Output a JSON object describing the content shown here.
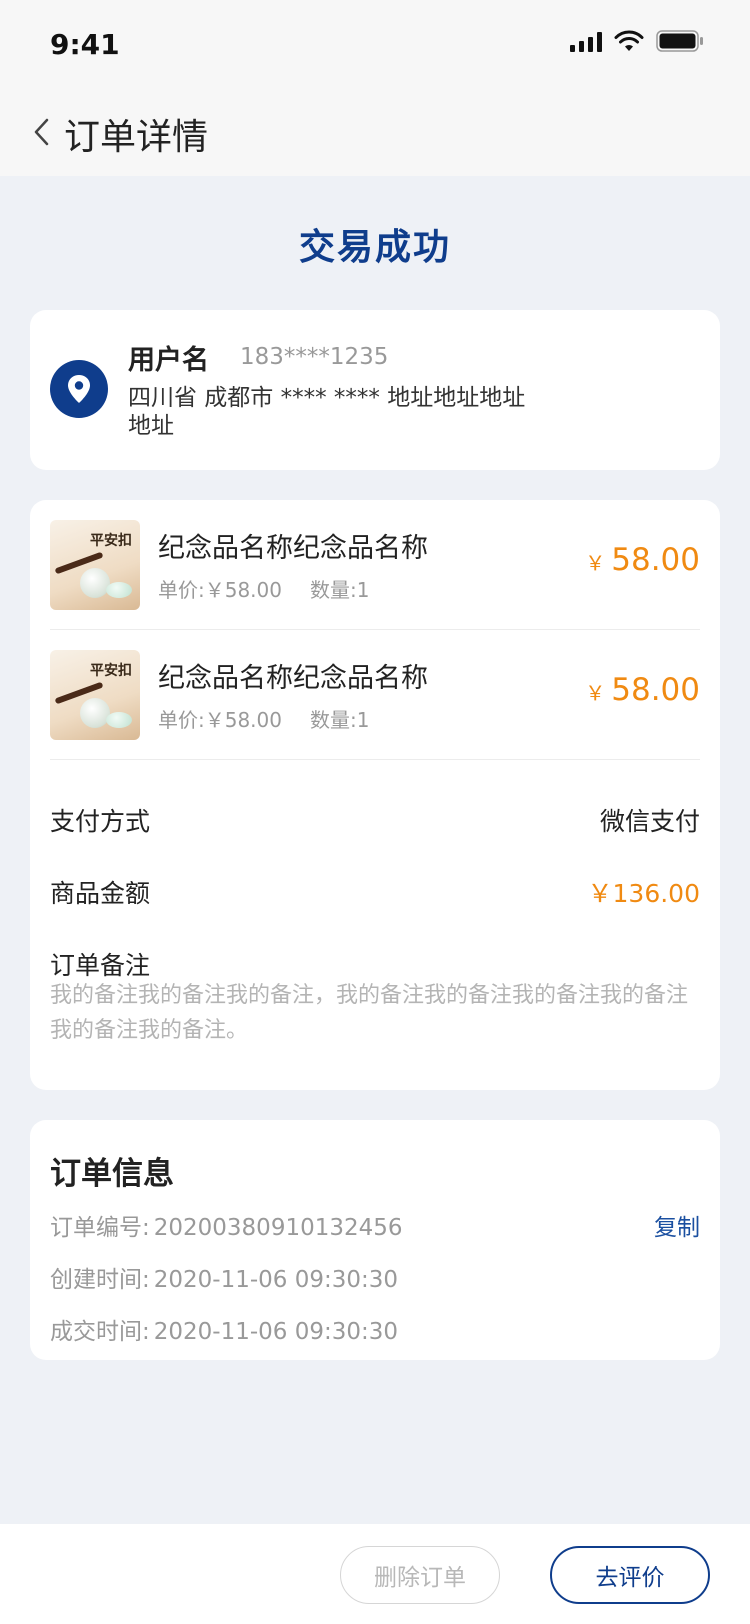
{
  "status_bar": {
    "time": "9:41"
  },
  "nav": {
    "title": "订单详情"
  },
  "trade_status": "交易成功",
  "address": {
    "name": "用户名",
    "phone": "183****1235",
    "address": "四川省 成都市 **** **** 地址地址地址地址"
  },
  "products": [
    {
      "name": "纪念品名称纪念品名称",
      "unit_price": "单价:￥58.00",
      "quantity": "数量:1",
      "price_symbol": "￥",
      "price": "58.00",
      "thumb_text": "平安扣"
    },
    {
      "name": "纪念品名称纪念品名称",
      "unit_price": "单价:￥58.00",
      "quantity": "数量:1",
      "price_symbol": "￥",
      "price": "58.00",
      "thumb_text": "平安扣"
    }
  ],
  "payment": {
    "label": "支付方式",
    "value": "微信支付"
  },
  "amount": {
    "label": "商品金额",
    "value": "￥136.00"
  },
  "remark": {
    "label": "订单备注",
    "text": "我的备注我的备注我的备注，我的备注我的备注我的备注我的备注我的备注我的备注。"
  },
  "order_info": {
    "title": "订单信息",
    "number_label": "订单编号:",
    "number": "20200380910132456",
    "copy_label": "复制",
    "created_label": "创建时间:",
    "created": "2020-11-06 09:30:30",
    "deal_label": "成交时间:",
    "deal": "2020-11-06 09:30:30"
  },
  "actions": {
    "delete": "删除订单",
    "review": "去评价"
  },
  "colors": {
    "primary": "#0f3d8c",
    "price": "#f08a12",
    "muted": "#999999",
    "background": "#eef1f6"
  }
}
